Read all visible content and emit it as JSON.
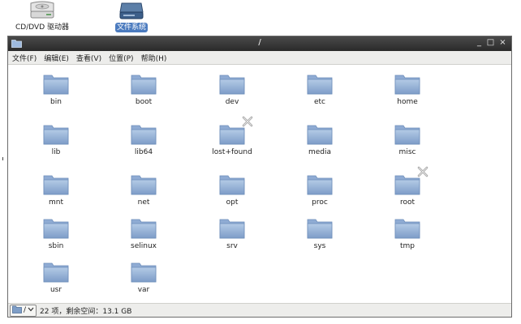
{
  "desktop": {
    "icons": [
      {
        "label": "CD/DVD 驱动器"
      },
      {
        "label": "文件系统"
      }
    ]
  },
  "window": {
    "title": "/",
    "controls": {
      "minimize": "_",
      "maximize": "□",
      "close": "×"
    }
  },
  "menubar": {
    "items": [
      {
        "label": "文件(F)"
      },
      {
        "label": "编辑(E)"
      },
      {
        "label": "查看(V)"
      },
      {
        "label": "位置(P)"
      },
      {
        "label": "帮助(H)"
      }
    ]
  },
  "folders": [
    {
      "name": "bin"
    },
    {
      "name": "boot"
    },
    {
      "name": "dev"
    },
    {
      "name": "etc"
    },
    {
      "name": "home"
    },
    {
      "name": "lib"
    },
    {
      "name": "lib64"
    },
    {
      "name": "lost+found",
      "emblem": "no-access-icon"
    },
    {
      "name": "media"
    },
    {
      "name": "misc"
    },
    {
      "name": "mnt"
    },
    {
      "name": "net"
    },
    {
      "name": "opt"
    },
    {
      "name": "proc"
    },
    {
      "name": "root",
      "emblem": "no-access-icon"
    },
    {
      "name": "sbin"
    },
    {
      "name": "selinux"
    },
    {
      "name": "srv"
    },
    {
      "name": "sys"
    },
    {
      "name": "tmp"
    },
    {
      "name": "usr"
    },
    {
      "name": "var"
    }
  ],
  "statusbar": {
    "path_label": "/",
    "status": "22 项，剩余空间：13.1 GB"
  },
  "colors": {
    "folder_top": "#b4cbe6",
    "folder_bottom": "#7d9cc8",
    "selection": "#4b7bbf",
    "titlebar": "#333333"
  }
}
